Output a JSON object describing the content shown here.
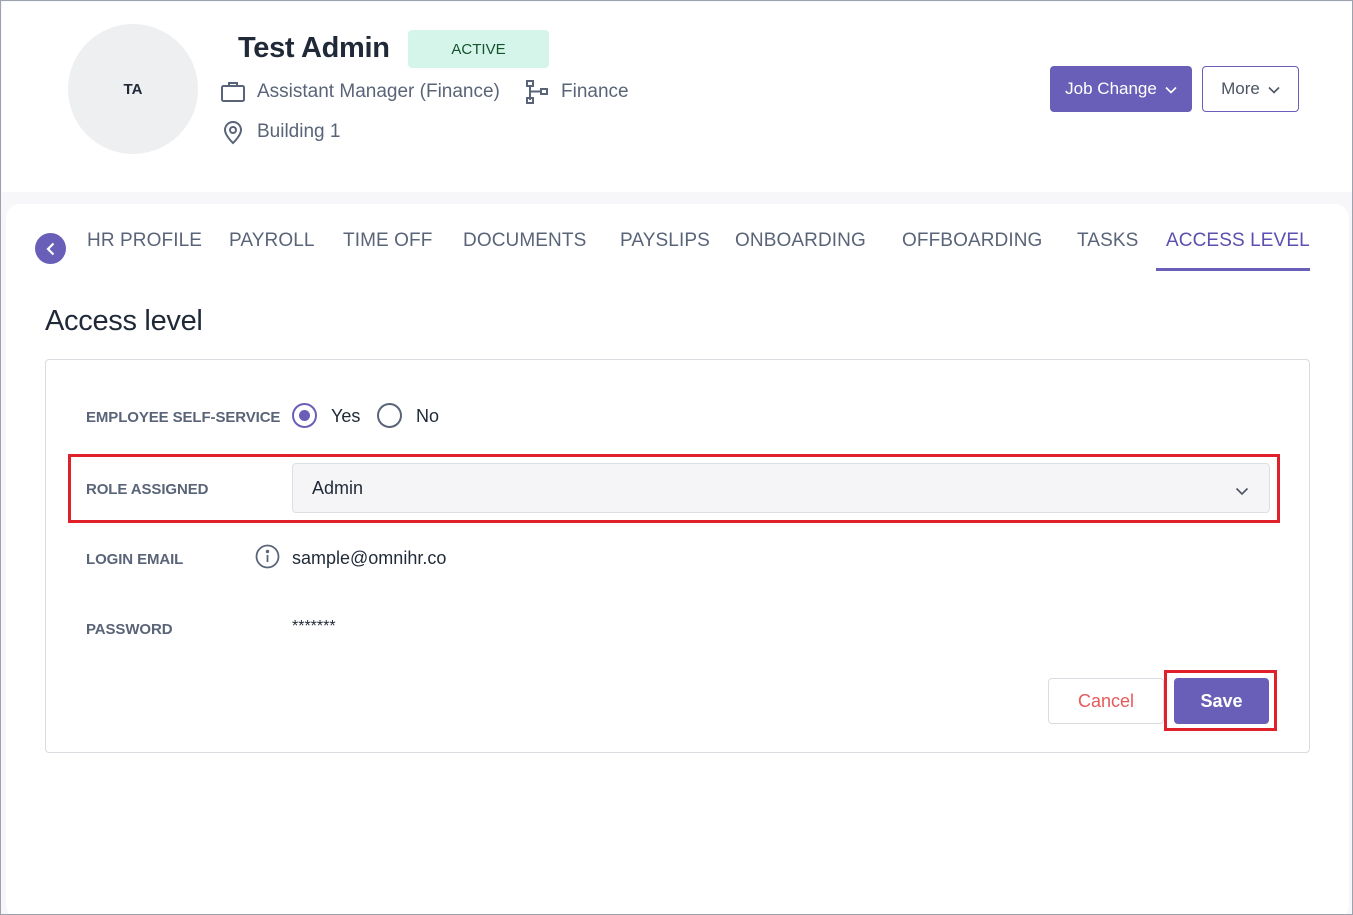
{
  "profile": {
    "initials": "TA",
    "name": "Test Admin",
    "status": "ACTIVE",
    "job_title": "Assistant Manager (Finance)",
    "department": "Finance",
    "location": "Building 1",
    "job_change_label": "Job Change",
    "more_label": "More",
    "icons": [
      "briefcase-icon",
      "org-chart-icon",
      "location-pin-icon",
      "chevron-down-icon"
    ]
  },
  "tabs": [
    {
      "label": "HR PROFILE"
    },
    {
      "label": "PAYROLL"
    },
    {
      "label": "TIME OFF"
    },
    {
      "label": "DOCUMENTS"
    },
    {
      "label": "PAYSLIPS"
    },
    {
      "label": "ONBOARDING"
    },
    {
      "label": "OFFBOARDING"
    },
    {
      "label": "TASKS"
    },
    {
      "label": "ACCESS LEVEL",
      "active": true
    }
  ],
  "access": {
    "title": "Access level",
    "ess_label": "EMPLOYEE SELF-SERVICE",
    "ess_yes": "Yes",
    "ess_no": "No",
    "ess_value": "Yes",
    "role_label": "ROLE ASSIGNED",
    "role_value": "Admin",
    "email_label": "LOGIN EMAIL",
    "email_value": "sample@omnihr.co",
    "password_label": "PASSWORD",
    "password_value": "*******",
    "cancel_label": "Cancel",
    "save_label": "Save"
  },
  "colors": {
    "accent": "#6a5fb8",
    "highlight": "#e0202a",
    "active_badge_bg": "#d6f5ea",
    "cancel_text": "#e65a5a"
  }
}
